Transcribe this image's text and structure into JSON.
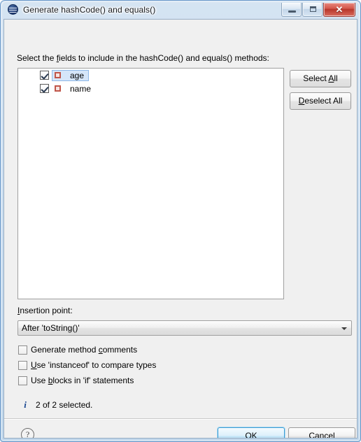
{
  "window": {
    "title": "Generate hashCode() and equals()",
    "icon": "eclipse-globe-icon",
    "controls": {
      "minimize": "minimize-button",
      "maximize": "maximize-button",
      "close_glyph": "✕"
    }
  },
  "content": {
    "prompt_before": "Select the ",
    "prompt_mnemonic": "f",
    "prompt_after": "ields to include in the hashCode() and equals() methods:",
    "fields": [
      {
        "name": "age",
        "checked": true,
        "selected": true
      },
      {
        "name": "name",
        "checked": true,
        "selected": false
      }
    ],
    "buttons": {
      "select_all_before": "Select ",
      "select_all_mnemonic": "A",
      "select_all_after": "ll",
      "deselect_all_before": "",
      "deselect_all_mnemonic": "D",
      "deselect_all_after": "eselect All"
    },
    "insertion": {
      "label_mnemonic": "I",
      "label_after": "nsertion point:",
      "value": "After 'toString()'"
    },
    "options": [
      {
        "before": "Generate method ",
        "mnemonic": "c",
        "after": "omments",
        "checked": false
      },
      {
        "before": "",
        "mnemonic": "U",
        "after": "se 'instanceof' to compare types",
        "checked": false
      },
      {
        "before": "Use ",
        "mnemonic": "b",
        "after": "locks in 'if' statements",
        "checked": false
      }
    ],
    "status": {
      "icon": "info-icon",
      "glyph": "i",
      "text": "2 of 2 selected."
    }
  },
  "footer": {
    "help_glyph": "?",
    "ok_label": "OK",
    "cancel_label": "Cancel"
  },
  "colors": {
    "frame": "#bcd4ea",
    "client_bg": "#f0f0f0",
    "selection_bg": "#d5e6f9",
    "selection_border": "#8db8e8",
    "field_icon": "#c0564a",
    "info": "#17458f",
    "default_button_border": "#3c9cd4",
    "close_button": "#b8372c"
  }
}
